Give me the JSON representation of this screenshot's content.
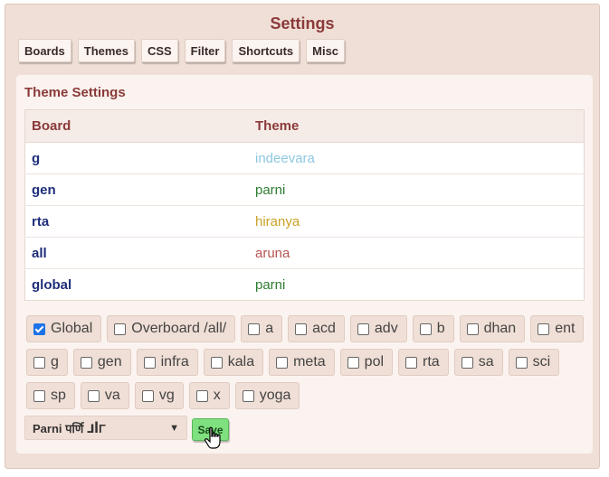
{
  "settings": {
    "title": "Settings",
    "tabs": [
      {
        "label": "Boards"
      },
      {
        "label": "Themes"
      },
      {
        "label": "CSS"
      },
      {
        "label": "Filter"
      },
      {
        "label": "Shortcuts"
      },
      {
        "label": "Misc"
      }
    ]
  },
  "theme_settings": {
    "title": "Theme Settings",
    "columns": {
      "board": "Board",
      "theme": "Theme"
    },
    "rows": [
      {
        "board": "g",
        "theme": "indeevara",
        "color": "#8ec8e0"
      },
      {
        "board": "gen",
        "theme": "parni",
        "color": "#2e7d32"
      },
      {
        "board": "rta",
        "theme": "hiranya",
        "color": "#c9a227"
      },
      {
        "board": "all",
        "theme": "aruna",
        "color": "#b85450"
      },
      {
        "board": "global",
        "theme": "parni",
        "color": "#2e7d32"
      }
    ],
    "board_checks": [
      {
        "label": "Global",
        "checked": true
      },
      {
        "label": "Overboard /all/",
        "checked": false
      },
      {
        "label": "a",
        "checked": false
      },
      {
        "label": "acd",
        "checked": false
      },
      {
        "label": "adv",
        "checked": false
      },
      {
        "label": "b",
        "checked": false
      },
      {
        "label": "dhan",
        "checked": false
      },
      {
        "label": "ent",
        "checked": false
      },
      {
        "label": "g",
        "checked": false
      },
      {
        "label": "gen",
        "checked": false
      },
      {
        "label": "infra",
        "checked": false
      },
      {
        "label": "kala",
        "checked": false
      },
      {
        "label": "meta",
        "checked": false
      },
      {
        "label": "pol",
        "checked": false
      },
      {
        "label": "rta",
        "checked": false
      },
      {
        "label": "sa",
        "checked": false
      },
      {
        "label": "sci",
        "checked": false
      },
      {
        "label": "sp",
        "checked": false
      },
      {
        "label": "va",
        "checked": false
      },
      {
        "label": "vg",
        "checked": false
      },
      {
        "label": "x",
        "checked": false
      },
      {
        "label": "yoga",
        "checked": false
      }
    ],
    "theme_select": {
      "value": "Parni पर्णि ⅃ꟾΓ"
    },
    "save_label": "Save"
  }
}
